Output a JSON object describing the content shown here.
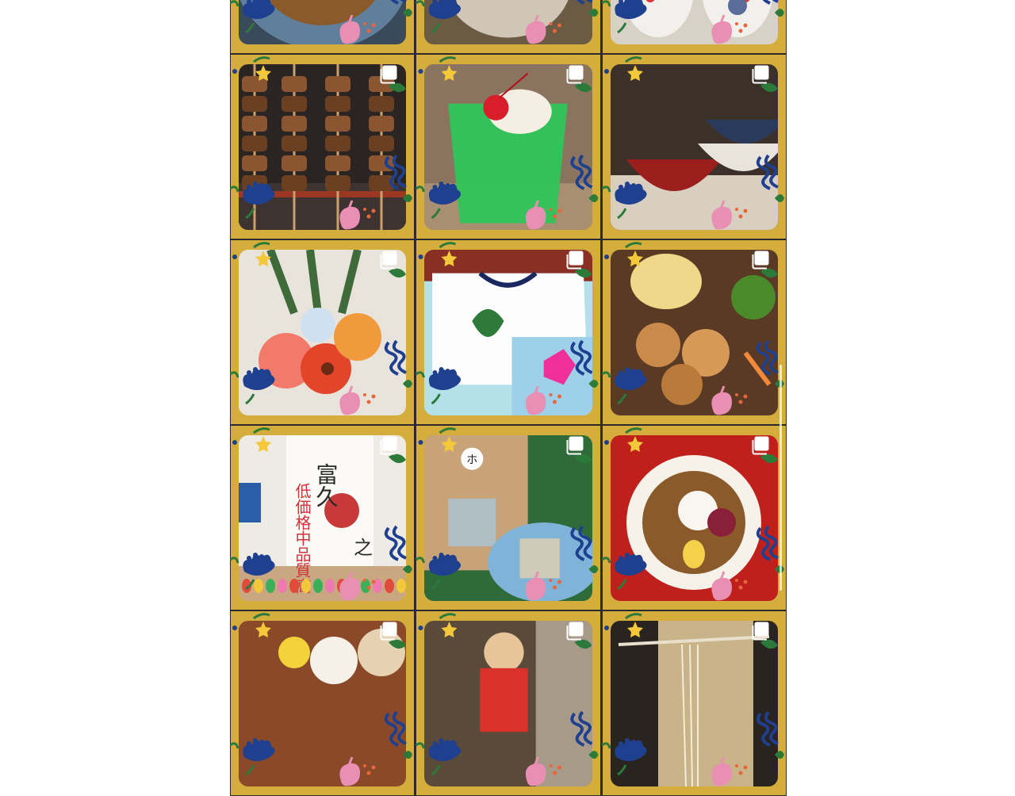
{
  "theme": {
    "frame_color": "#d4ad3c",
    "divider_color": "#2b2b2b",
    "accent_blue": "#1f3f8f",
    "accent_green": "#2c7a3a",
    "accent_pink": "#ea8fb4",
    "accent_orange": "#e8663a"
  },
  "grid": {
    "columns": 3,
    "posts": [
      {
        "name": "post-grilled-dish",
        "subject": "grilled",
        "multi": false
      },
      {
        "name": "post-bread",
        "subject": "bread",
        "multi": false
      },
      {
        "name": "post-ceramic-figurines",
        "subject": "ceramics",
        "multi": false
      },
      {
        "name": "post-yakitori-skewers",
        "subject": "skewers",
        "multi": true
      },
      {
        "name": "post-melon-soda-float",
        "subject": "soda",
        "multi": true
      },
      {
        "name": "post-lacquer-bowls",
        "subject": "bowls",
        "multi": true
      },
      {
        "name": "post-flower-bouquet",
        "subject": "flowers",
        "multi": true
      },
      {
        "name": "post-tshirt-tote-bag",
        "subject": "shirt",
        "multi": true
      },
      {
        "name": "post-karaage-bento",
        "subject": "karaage",
        "multi": true
      },
      {
        "name": "post-calligraphy-event",
        "subject": "calligraphy",
        "multi": true
      },
      {
        "name": "post-tea-bags",
        "subject": "tea",
        "multi": true
      },
      {
        "name": "post-curry-plate",
        "subject": "curry",
        "multi": true
      },
      {
        "name": "post-onigiri-plate",
        "subject": "onigiri",
        "multi": true
      },
      {
        "name": "post-child-portrait",
        "subject": "child",
        "multi": true
      },
      {
        "name": "post-noodles",
        "subject": "noodles",
        "multi": true
      }
    ]
  },
  "calligraphy_text": {
    "left_column": "低価格中品質高",
    "right_column": "富久",
    "sign": "之"
  },
  "tea_bag_logo": "ホ",
  "icons": {
    "multi_post": "carousel-stack-icon",
    "decor": [
      "blue-flower-icon",
      "pink-bud-icon",
      "green-leaf-icon",
      "blue-wave-icon",
      "yellow-star-icon"
    ]
  }
}
